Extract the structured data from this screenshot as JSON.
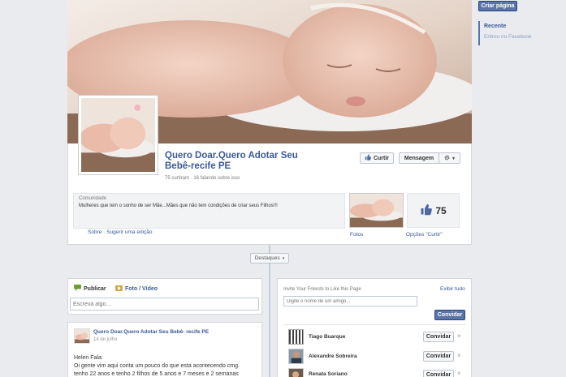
{
  "right_rail": {
    "create_page_label": "Criar página",
    "recent_label": "Recente",
    "joined_label": "Entrou no Facebook"
  },
  "page": {
    "title_line1": "Quero Doar.Quero Adotar Seu",
    "title_line2": "Bebê-recife PE",
    "stats": "75 curtiram · 16 falando sobre isso",
    "like_button": "Curtir",
    "message_button": "Mensagem",
    "gear_caret": "▾",
    "category": "Comunidade",
    "description": "Mulheres que tem o sonho de ser Mãe...Mães que não tem condições de criar seus Filhos!!!",
    "about_link": "Sobre",
    "separator": " · ",
    "suggest_link": "Sugerir uma edição",
    "photos_label": "Fotos",
    "likes_count": "75",
    "likes_options_label": "Opções \"Curtir\""
  },
  "timeline": {
    "highlights_label": "Destaques",
    "highlights_caret": "▾"
  },
  "composer": {
    "publish_tab": "Publicar",
    "photo_tab": "Foto / Vídeo",
    "placeholder": "Escreva algo..."
  },
  "post": {
    "author": "Quero Doar.Quero Adotar Seu Bebê- recife PE",
    "date": "14 de julho",
    "line1": "Helen Fala:",
    "line2": "Oi gente vim aqui conta um pouco do que esta acontecendo cmg.",
    "line3": "tenho 22 anos e tenho 2 filhos de 5 anos e 7 meses e 2 semanas"
  },
  "invite": {
    "title": "Invite Your Friends to Like this Page",
    "see_all": "Exibir tudo",
    "placeholder": "Digite o nome de um amigo...",
    "invite_button": "Convidar",
    "friends": [
      {
        "name": "Tiago Buarque",
        "action": "Convidar",
        "remove": "×"
      },
      {
        "name": "Alexandre Sobreira",
        "action": "Convidar",
        "remove": "×"
      },
      {
        "name": "Renata Soriano",
        "action": "Convidar",
        "remove": "×"
      }
    ]
  },
  "colors": {
    "brand_blue": "#3b5998",
    "button_blue": "#5b74a8",
    "page_bg": "#e9ebee"
  },
  "icons": [
    "like-thumb-icon",
    "gear-icon",
    "publish-icon",
    "photo-icon",
    "thumbs-up-icon",
    "qr-avatar-icon"
  ]
}
